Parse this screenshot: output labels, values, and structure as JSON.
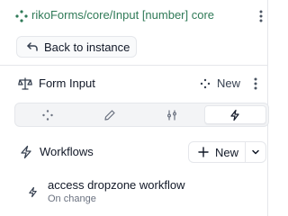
{
  "header": {
    "breadcrumb_title": "rikoForms/core/Input [number] core",
    "back_label": "Back to instance"
  },
  "form_section": {
    "title": "Form Input",
    "new_label": "New"
  },
  "tabs": [
    {
      "icon": "move-icon",
      "active": false
    },
    {
      "icon": "pencil-icon",
      "active": false
    },
    {
      "icon": "sliders-icon",
      "active": false
    },
    {
      "icon": "bolt-icon",
      "active": true
    }
  ],
  "workflows": {
    "title": "Workflows",
    "new_label": "New",
    "items": [
      {
        "title": "access dropzone workflow",
        "trigger": "On change"
      }
    ]
  },
  "colors": {
    "brand_green": "#2f7a57",
    "border": "#e5e7eb",
    "muted_text": "#6b7280"
  }
}
